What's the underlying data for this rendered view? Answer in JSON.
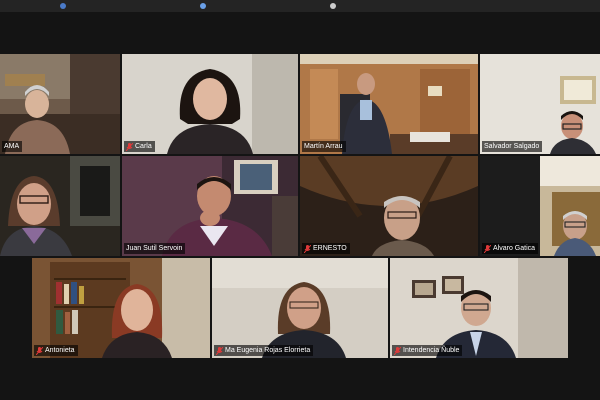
{
  "window": {
    "top_bar_items": [
      "",
      "",
      ""
    ]
  },
  "participants": [
    {
      "name": "AMA",
      "muted": false
    },
    {
      "name": "Carla",
      "muted": true
    },
    {
      "name": "Martín Arrau",
      "muted": false
    },
    {
      "name": "Salvador Salgado",
      "muted": false
    },
    {
      "name": "",
      "muted": false,
      "active_speaker": true
    },
    {
      "name": "Juan Sutil Servoin",
      "muted": false
    },
    {
      "name": "ERNESTO",
      "muted": true
    },
    {
      "name": "Alvaro Gatica",
      "muted": true
    },
    {
      "name": "Antonieta",
      "muted": true
    },
    {
      "name": "Ma Eugenia Rojas Elorrieta",
      "muted": true
    },
    {
      "name": "Intendencia Ñuble",
      "muted": true
    }
  ],
  "colors": {
    "background": "#141414",
    "active_speaker_border": "#e5e14a",
    "muted_icon": "#e03a3a"
  },
  "icons": [
    "microphone-muted-icon"
  ]
}
